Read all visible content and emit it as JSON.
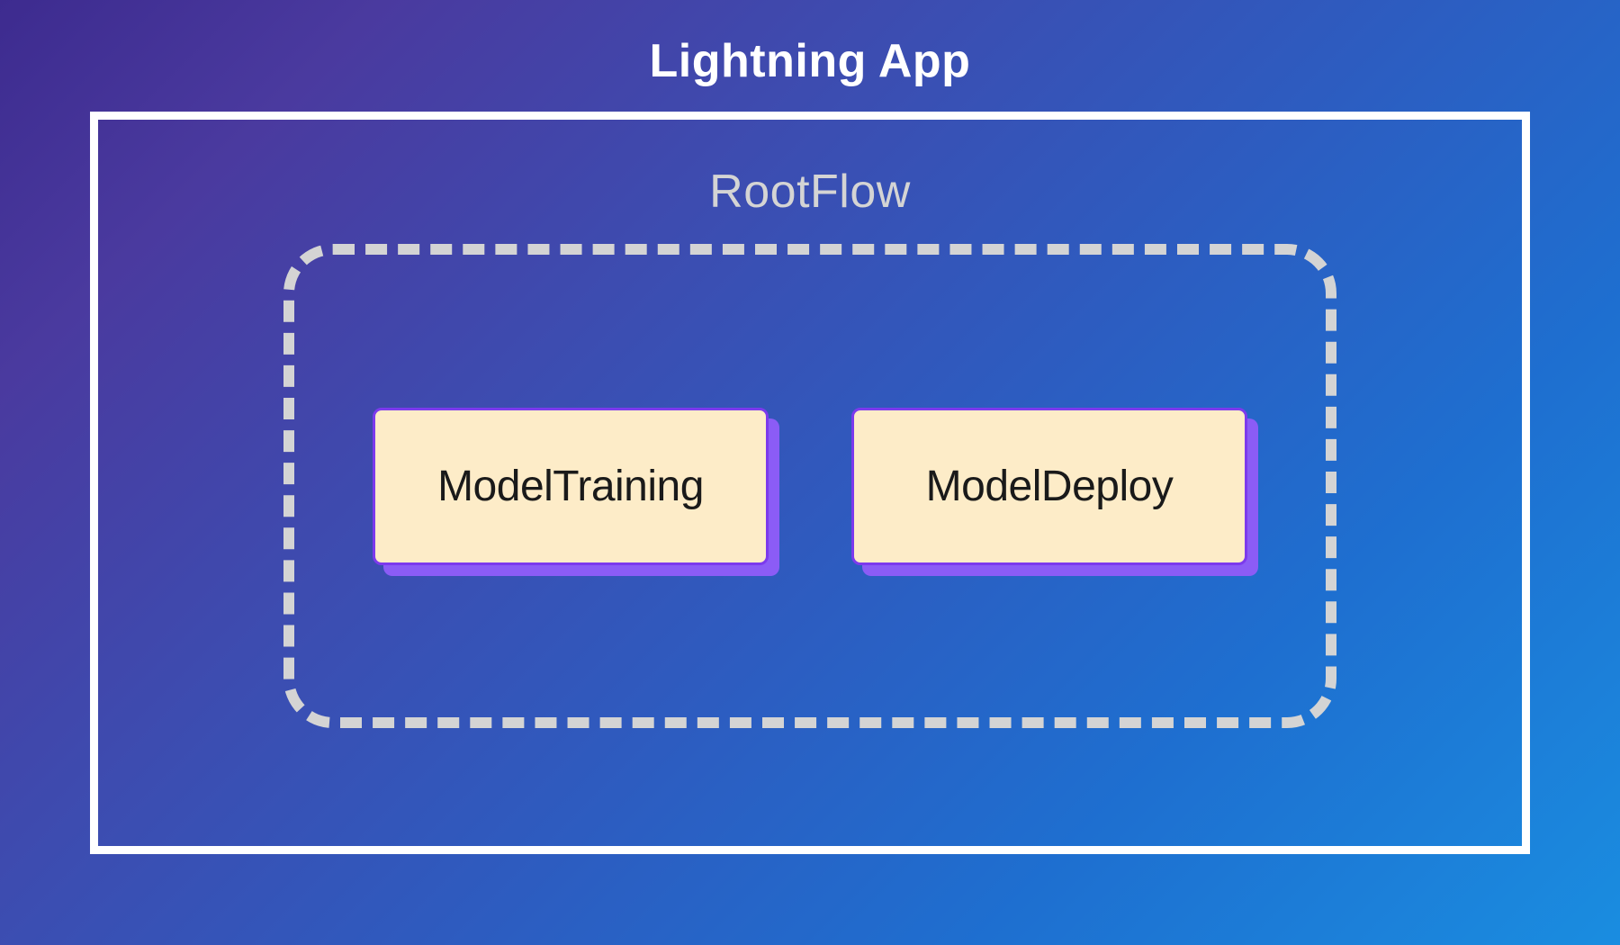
{
  "diagram": {
    "app_title": "Lightning App",
    "rootflow_title": "RootFlow",
    "components": [
      {
        "label": "ModelTraining"
      },
      {
        "label": "ModelDeploy"
      }
    ]
  }
}
